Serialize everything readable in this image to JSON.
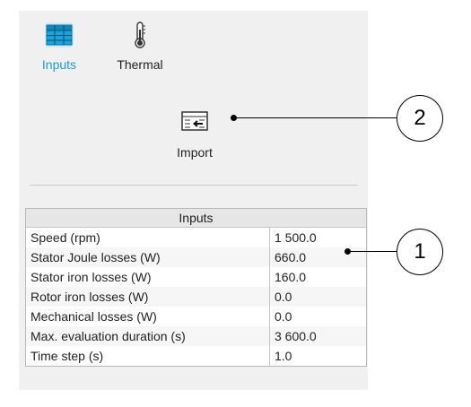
{
  "toolbar": {
    "inputs_label": "Inputs",
    "thermal_label": "Thermal",
    "import_label": "Import"
  },
  "table": {
    "header": "Inputs",
    "rows": [
      {
        "label": "Speed (rpm)",
        "value": "1 500.0"
      },
      {
        "label": "Stator Joule losses (W)",
        "value": "660.0"
      },
      {
        "label": "Stator iron losses (W)",
        "value": "160.0"
      },
      {
        "label": "Rotor iron losses (W)",
        "value": "0.0"
      },
      {
        "label": "Mechanical losses (W)",
        "value": "0.0"
      },
      {
        "label": "Max. evaluation duration (s)",
        "value": "3 600.0"
      },
      {
        "label": "Time step (s)",
        "value": "1.0"
      }
    ]
  },
  "callouts": {
    "one": "1",
    "two": "2"
  },
  "colors": {
    "active_accent": "#1a9ed6",
    "panel_bg": "#f0f0f0"
  },
  "icons": {
    "inputs": "table-grid-icon",
    "thermal": "thermometer-icon",
    "import": "import-arrow-icon"
  }
}
